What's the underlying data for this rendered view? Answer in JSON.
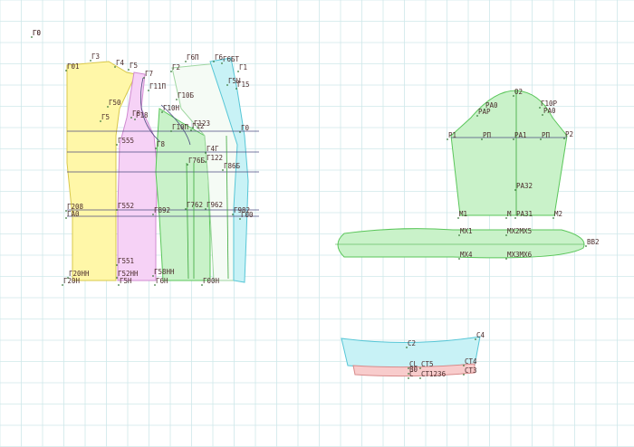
{
  "origin_label": "Г0",
  "pieces": {
    "front": {
      "labels": [
        "Г0",
        "Г01",
        "Г3",
        "Г4",
        "Г5",
        "Г7",
        "Г2",
        "Г6П",
        "Г6",
        "Г6БТ",
        "Г1",
        "Г5Ы",
        "Г15",
        "Г11П",
        "Г10Б",
        "Г10Н",
        "Г50",
        "Г5",
        "Г8",
        "Г18",
        "Г10П",
        "Г12",
        "Г123",
        "Г0",
        "Г555",
        "Г8",
        "Г4Г",
        "Г122",
        "Г76Б",
        "Г86Б",
        "Г208",
        "ГА0",
        "Г552",
        "Г892",
        "Г762",
        "Г962",
        "Г982",
        "Г00",
        "Г551",
        "Г20НН",
        "Г52НН",
        "Г58НН",
        "Г20Н",
        "Г5Н",
        "Г6Н",
        "Г00Н"
      ]
    },
    "back_sleeve": {
      "labels": [
        "О2",
        "РА0",
        "РАР",
        "Г10Р",
        "РА0",
        "Р1",
        "РП",
        "РА1",
        "РП",
        "Р2",
        "РА32",
        "М1",
        "М",
        "РА31",
        "М2",
        "МХ1",
        "МХ2МХ5",
        "ВВ2",
        "МХ4",
        "МХ3МХ6"
      ]
    },
    "collar": {
      "labels": [
        "С2",
        "С4",
        "СL",
        "СТ5",
        "СТ4",
        "В0",
        "С",
        "СТ1236",
        "СТ3"
      ]
    }
  }
}
